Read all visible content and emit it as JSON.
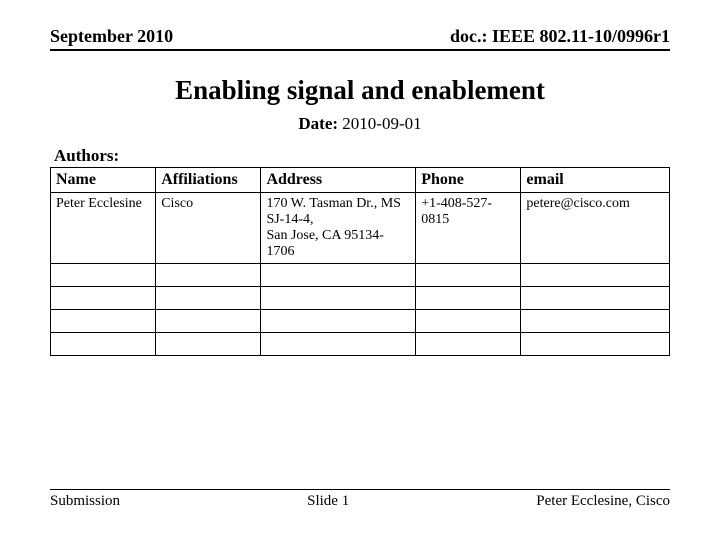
{
  "header": {
    "left": "September 2010",
    "right": "doc.: IEEE 802.11-10/0996r1"
  },
  "title": "Enabling signal and enablement",
  "date": {
    "label": "Date:",
    "value": "2010-09-01"
  },
  "authors_label": "Authors:",
  "table": {
    "headers": [
      "Name",
      "Affiliations",
      "Address",
      "Phone",
      "email"
    ],
    "row": {
      "name": "Peter Ecclesine",
      "affiliation": "Cisco",
      "address": "170 W. Tasman Dr., MS SJ-14-4,\n San Jose, CA 95134-1706",
      "phone": "+1-408-527-0815",
      "email": "petere@cisco.com"
    }
  },
  "footer": {
    "left": "Submission",
    "center": "Slide 1",
    "right": "Peter Ecclesine, Cisco"
  }
}
